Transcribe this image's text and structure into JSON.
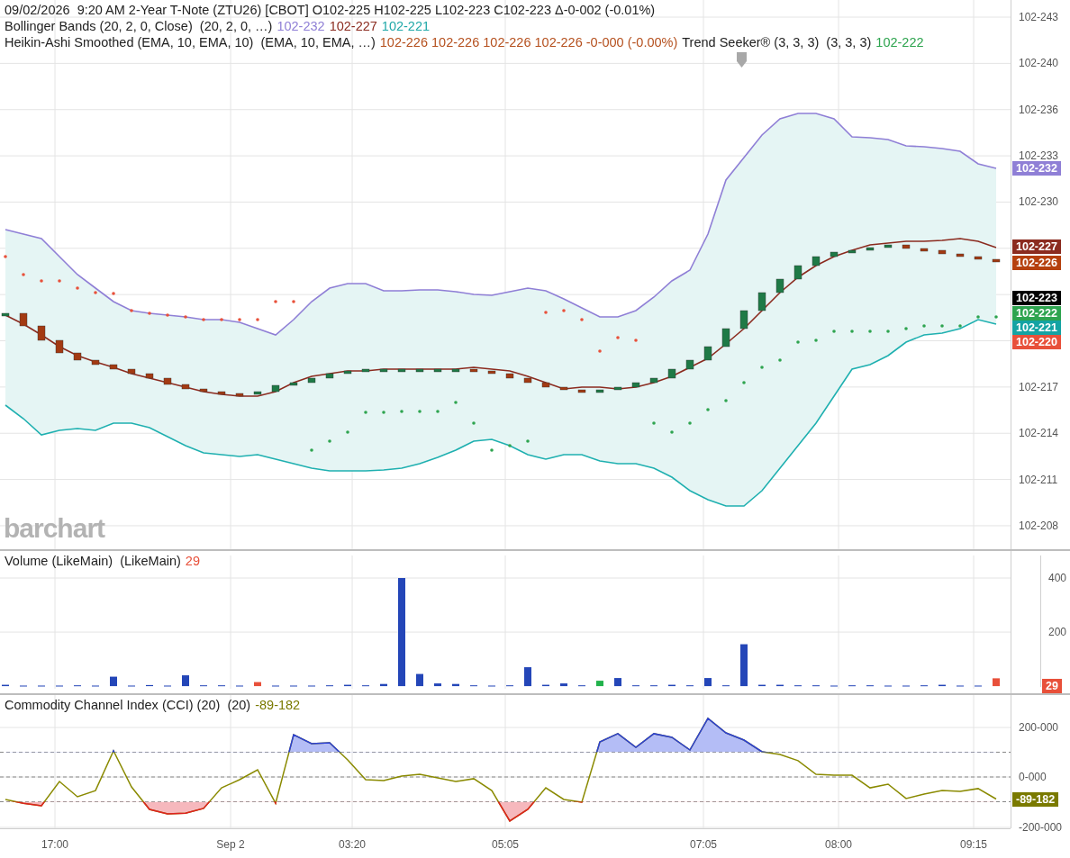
{
  "main": {
    "legend": [
      [
        {
          "text": "09/02/2026  9:20 AM 2-Year T-Note (ZTU26) [CBOT] O102-225 H102-225 L102-223 C102-223 Δ-0-002 (-0.01%)",
          "color": "#222222"
        }
      ],
      [
        {
          "text": "Bollinger Bands (20, 2, 0, Close)  (20, 2, 0, …)",
          "color": "#222222"
        },
        {
          "text": "102-232",
          "color": "#8f7fd6"
        },
        {
          "text": "102-227",
          "color": "#8b2b1f"
        },
        {
          "text": "102-221",
          "color": "#1fa8a8"
        }
      ],
      [
        {
          "text": "Heikin-Ashi Smoothed (EMA, 10, EMA, 10)  (EMA, 10, EMA, …)",
          "color": "#222222"
        },
        {
          "text": "102-226 102-226 102-226 102-226 -0-000 (-0.00%)",
          "color": "#b5501e"
        },
        {
          "text": "Trend Seeker® (3, 3, 3)  (3, 3, 3)",
          "color": "#222222"
        },
        {
          "text": "102-222",
          "color": "#2ea44f"
        }
      ]
    ],
    "logo": "barchart",
    "axis_labels": [
      "102-243",
      "102-240",
      "102-236",
      "102-233",
      "102-230",
      "102-217",
      "102-214",
      "102-211",
      "102-208"
    ],
    "badges": [
      {
        "label": "102-232",
        "color": "#8f7fd6"
      },
      {
        "label": "102-227",
        "color": "#8b2b1f"
      },
      {
        "label": "102-226",
        "color": "#b5400e"
      },
      {
        "label": "102-223",
        "color": "#000000"
      },
      {
        "label": "102-222",
        "color": "#2ea44f"
      },
      {
        "label": "102-221",
        "color": "#14a3a3"
      },
      {
        "label": "102-220",
        "color": "#e8503a"
      }
    ]
  },
  "volume": {
    "legend": [
      {
        "text": "Volume (LikeMain)  (LikeMain)",
        "color": "#222222"
      },
      {
        "text": "29",
        "color": "#e8503a"
      }
    ],
    "chart_data": {
      "type": "bar",
      "grid": true,
      "ylim": [
        -33,
        500
      ],
      "yticks": [
        {
          "value": 400,
          "label": "400"
        },
        {
          "value": 200,
          "label": "200"
        }
      ],
      "series": [
        {
          "color": "#2446b8",
          "values": [
            5,
            2,
            2,
            2,
            3,
            2,
            35,
            2,
            4,
            2,
            40,
            3,
            3,
            2,
            null,
            2,
            2,
            2,
            3,
            5,
            3,
            8,
            400,
            45,
            10,
            8,
            3,
            2,
            3,
            70,
            5,
            10,
            3,
            null,
            30,
            3,
            3,
            5,
            3,
            30,
            3,
            155,
            5,
            5,
            3,
            3,
            2,
            3,
            3,
            2,
            2,
            3,
            5,
            2,
            2,
            null
          ]
        },
        {
          "color": "#e8503a",
          "values": [
            null,
            null,
            null,
            null,
            null,
            null,
            null,
            null,
            null,
            null,
            null,
            null,
            null,
            null,
            15,
            null,
            null,
            null,
            null,
            null,
            null,
            null,
            null,
            null,
            null,
            null,
            null,
            null,
            null,
            null,
            null,
            null,
            null,
            null,
            null,
            null,
            null,
            null,
            null,
            null,
            null,
            null,
            null,
            null,
            null,
            null,
            null,
            null,
            null,
            null,
            null,
            null,
            null,
            null,
            null,
            29
          ]
        },
        {
          "color": "#22b24c",
          "values": [
            null,
            null,
            null,
            null,
            null,
            null,
            null,
            null,
            null,
            null,
            null,
            null,
            null,
            null,
            null,
            null,
            null,
            null,
            null,
            null,
            null,
            null,
            null,
            null,
            null,
            null,
            null,
            null,
            null,
            null,
            null,
            null,
            null,
            20,
            null,
            null,
            null,
            null,
            null,
            null,
            null,
            null,
            null,
            null,
            null,
            null,
            null,
            null,
            null,
            null,
            null,
            null,
            null,
            null,
            null,
            null
          ]
        }
      ]
    },
    "badges": [
      {
        "label": "29",
        "color": "#e8503a"
      }
    ]
  },
  "cci": {
    "legend": [
      {
        "text": "Commodity Channel Index (CCI) (20)  (20)",
        "color": "#222222"
      },
      {
        "text": "-89-182",
        "color": "#7a7a00"
      }
    ],
    "axis_labels": [
      "200-000",
      "0-000",
      "-200-000"
    ],
    "badges": [
      {
        "label": "-89-182",
        "color": "#7a7a00"
      }
    ]
  },
  "time_axis": [
    "17:00",
    "Sep 2",
    "03:20",
    "05:05",
    "07:05",
    "08:00",
    "09:15"
  ]
}
